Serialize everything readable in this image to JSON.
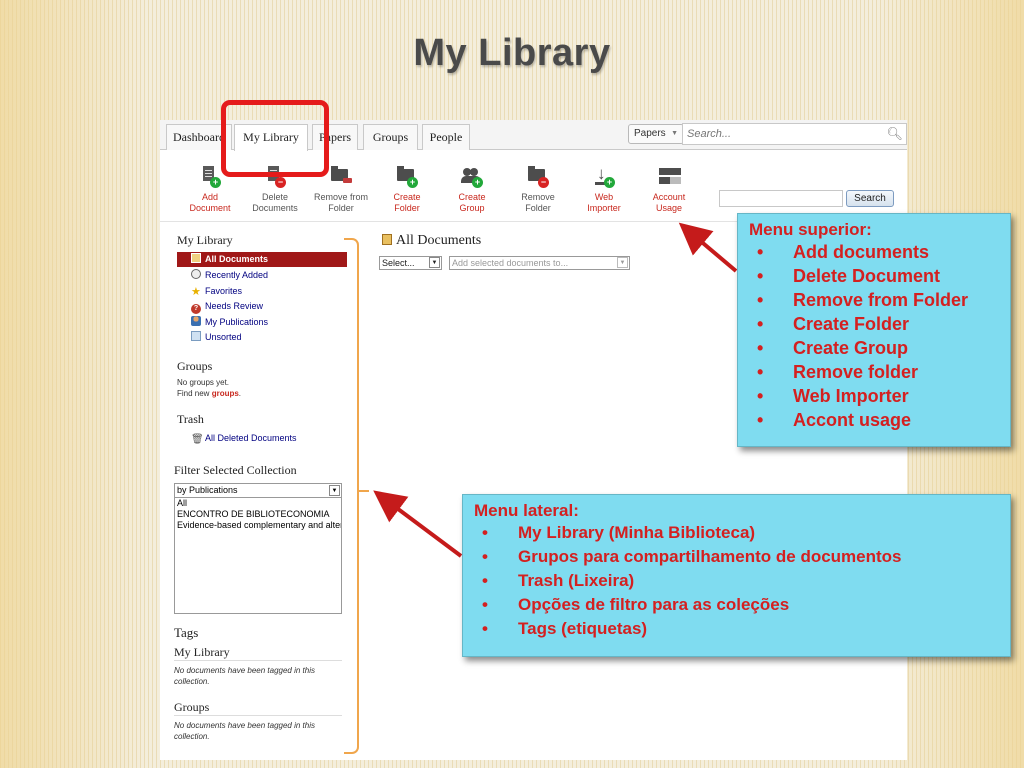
{
  "slide": {
    "title": "My Library"
  },
  "tabs": [
    {
      "label": "Dashboard"
    },
    {
      "label": "My Library"
    },
    {
      "label": "Papers"
    },
    {
      "label": "Groups"
    },
    {
      "label": "People"
    }
  ],
  "search_top": {
    "scope": "Papers",
    "placeholder": "Search..."
  },
  "toolbar": {
    "items": [
      {
        "line1": "Add",
        "line2": "Document",
        "icon": "add-document-icon"
      },
      {
        "line1": "Delete",
        "line2": "Documents",
        "icon": "delete-document-icon"
      },
      {
        "line1": "Remove from",
        "line2": "Folder",
        "icon": "remove-from-folder-icon"
      },
      {
        "line1": "Create",
        "line2": "Folder",
        "icon": "create-folder-icon"
      },
      {
        "line1": "Create",
        "line2": "Group",
        "icon": "create-group-icon"
      },
      {
        "line1": "Remove",
        "line2": "Folder",
        "icon": "remove-folder-icon"
      },
      {
        "line1": "Web",
        "line2": "Importer",
        "icon": "web-importer-icon"
      },
      {
        "line1": "Account",
        "line2": "Usage",
        "icon": "account-usage-icon"
      }
    ],
    "search_button": "Search"
  },
  "sidebar": {
    "library_heading": "My Library",
    "items": [
      {
        "label": "All Documents",
        "icon": "documents-icon",
        "selected": true
      },
      {
        "label": "Recently Added",
        "icon": "clock-icon"
      },
      {
        "label": "Favorites",
        "icon": "star-icon"
      },
      {
        "label": "Needs Review",
        "icon": "question-icon"
      },
      {
        "label": "My Publications",
        "icon": "person-icon"
      },
      {
        "label": "Unsorted",
        "icon": "tray-icon"
      }
    ],
    "groups_heading": "Groups",
    "groups_none": "No groups yet.",
    "groups_find_prefix": "Find new ",
    "groups_find_link": "groups",
    "groups_find_suffix": ".",
    "trash_heading": "Trash",
    "trash_item": "All Deleted Documents",
    "filter_heading": "Filter Selected Collection",
    "filter_select": "by Publications",
    "filter_options": [
      "All",
      "ENCONTRO DE BIBLIOTECONOMIA",
      "Evidence-based complementary and alternative medicine"
    ],
    "tags_heading": "Tags",
    "tags_library_heading": "My Library",
    "tags_library_note": "No documents have been tagged in this collection.",
    "tags_groups_heading": "Groups",
    "tags_groups_note": "No documents have been tagged in this collection."
  },
  "main": {
    "title": "All Documents",
    "select_label": "Select...",
    "add_to_placeholder": "Add selected documents to..."
  },
  "callout_top": {
    "title": "Menu superior:",
    "items": [
      "Add documents",
      "Delete Document",
      "Remove from Folder",
      "Create Folder",
      "Create Group",
      "Remove folder",
      "Web Importer",
      "Accont usage"
    ]
  },
  "callout_side": {
    "title": "Menu lateral:",
    "items": [
      "My Library (Minha Biblioteca)",
      "Grupos para compartilhamento de documentos",
      "Trash (Lixeira)",
      "Opções de filtro para as coleções",
      "Tags (etiquetas)"
    ]
  },
  "colors": {
    "callout_bg": "#7fdcf0",
    "callout_text": "#d42020",
    "highlight": "#e51b1b",
    "selected_item": "#a01818",
    "bracket": "#f0a64c"
  }
}
